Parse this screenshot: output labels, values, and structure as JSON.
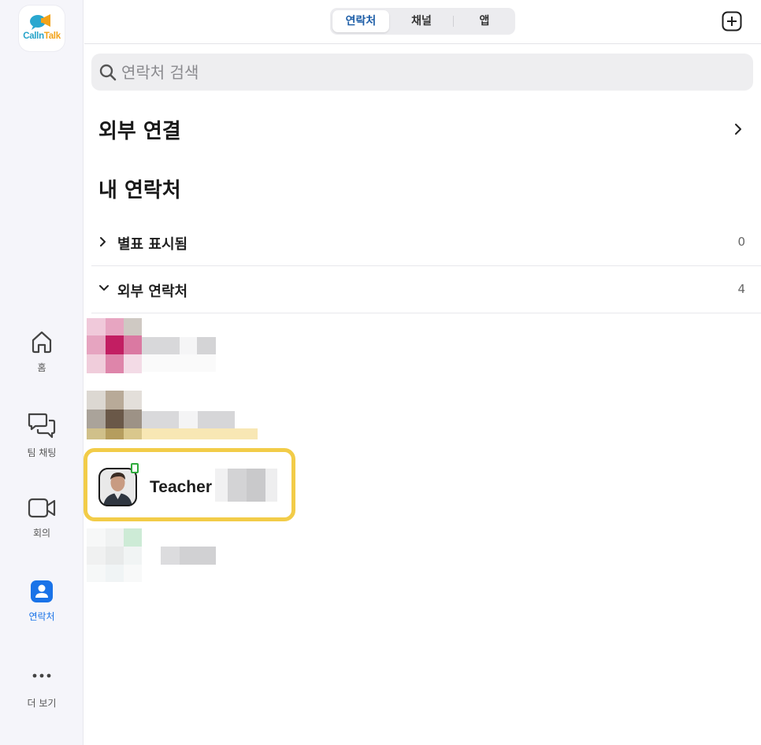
{
  "app": {
    "logo_text_a": "Call",
    "logo_text_b": "n",
    "logo_text_c": "Talk"
  },
  "sidebar": {
    "items": [
      {
        "label": "홈",
        "icon": "home-icon"
      },
      {
        "label": "팀 채팅",
        "icon": "chat-bubbles-icon"
      },
      {
        "label": "회의",
        "icon": "video-camera-icon"
      },
      {
        "label": "연락처",
        "icon": "contacts-icon",
        "active": true
      },
      {
        "label": "더 보기",
        "icon": "more-dots-icon"
      }
    ]
  },
  "topbar": {
    "tabs": [
      {
        "label": "연락처",
        "active": true
      },
      {
        "label": "채널"
      },
      {
        "label": "앱"
      }
    ],
    "add_icon": "plus-square-icon"
  },
  "search": {
    "placeholder": "연락처 검색",
    "value": ""
  },
  "sections": {
    "external_connection": "외부 연결",
    "my_contacts": "내 연락처",
    "groups": [
      {
        "label": "별표 표시됨",
        "count": "0",
        "expanded": false
      },
      {
        "label": "외부 연락처",
        "count": "4",
        "expanded": true
      }
    ]
  },
  "contacts": {
    "highlighted_name": "Teacher"
  },
  "colors": {
    "accent": "#1a73e8",
    "highlight_border": "#f2cc48",
    "online": "#2eaa3c"
  }
}
